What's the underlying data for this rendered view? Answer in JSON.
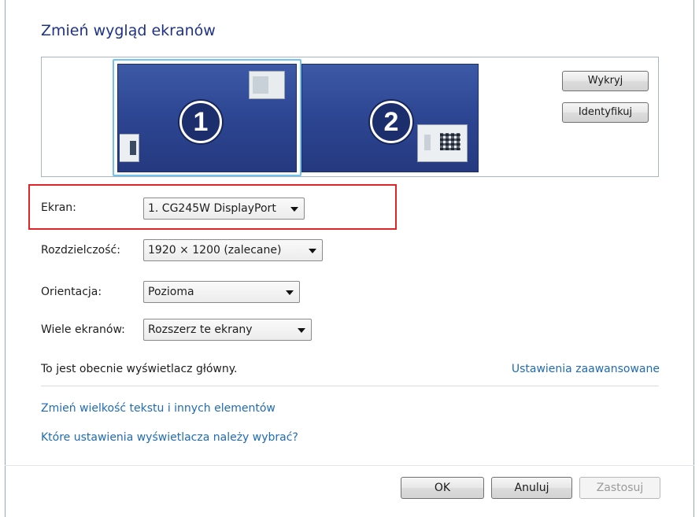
{
  "page_title": "Zmień wygląd ekranów",
  "monitors": [
    {
      "number": "1",
      "selected": true
    },
    {
      "number": "2",
      "selected": false
    }
  ],
  "side_buttons": {
    "detect": "Wykryj",
    "identify": "Identyfikuj"
  },
  "fields": {
    "display": {
      "label": "Ekran:",
      "value": "1. CG245W DisplayPort"
    },
    "resolution": {
      "label": "Rozdzielczość:",
      "value": "1920 × 1200 (zalecane)"
    },
    "orientation": {
      "label": "Orientacja:",
      "value": "Pozioma"
    },
    "multiple_displays": {
      "label": "Wiele ekranów:",
      "value": "Rozszerz te ekrany"
    }
  },
  "status_text": "To jest obecnie wyświetlacz główny.",
  "advanced_settings_link": "Ustawienia zaawansowane",
  "links": {
    "text_size": "Zmień wielkość tekstu i innych elementów",
    "which_settings": "Które ustawienia wyświetlacza należy wybrać?"
  },
  "footer": {
    "ok": "OK",
    "cancel": "Anuluj",
    "apply": "Zastosuj"
  },
  "colors": {
    "title": "#1e3287",
    "link": "#1f6bb5",
    "highlight_border": "#e1242a",
    "monitor_fill": "#2e4794",
    "selection_border": "#6fc3ef"
  }
}
